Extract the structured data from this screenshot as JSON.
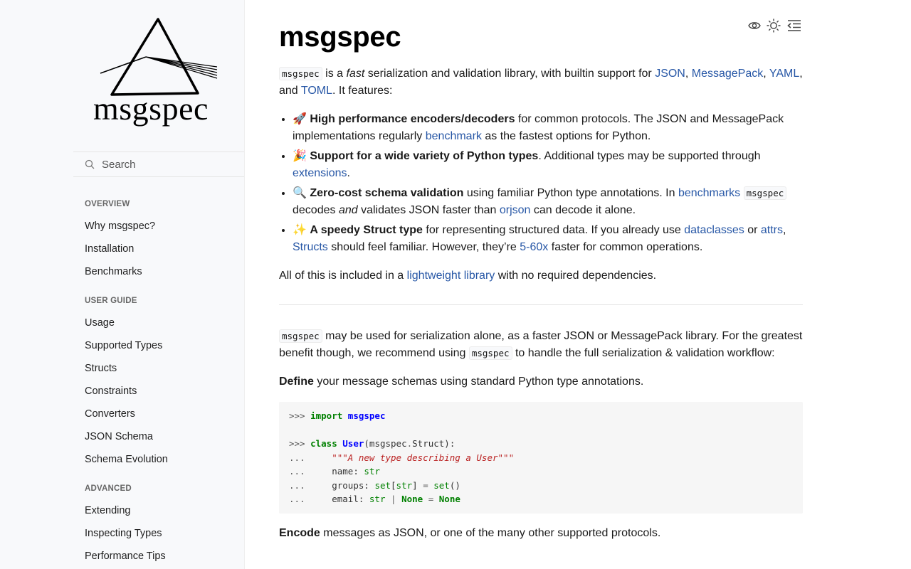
{
  "sidebar": {
    "brand_text": "msgspec",
    "search_placeholder": "Search",
    "sections": [
      {
        "caption": "OVERVIEW",
        "items": [
          "Why msgspec?",
          "Installation",
          "Benchmarks"
        ]
      },
      {
        "caption": "USER GUIDE",
        "items": [
          "Usage",
          "Supported Types",
          "Structs",
          "Constraints",
          "Converters",
          "JSON Schema",
          "Schema Evolution"
        ]
      },
      {
        "caption": "ADVANCED",
        "items": [
          "Extending",
          "Inspecting Types",
          "Performance Tips"
        ]
      }
    ]
  },
  "toolbar": {
    "icons": [
      "eye-icon",
      "theme-sun-icon",
      "toc-icon"
    ]
  },
  "main": {
    "title": "msgspec",
    "intro": {
      "code": "msgspec",
      "t1": " is a ",
      "em": "fast",
      "t2": " serialization and validation library, with builtin support for ",
      "l1": "JSON",
      "t3": ", ",
      "l2": "MessagePack",
      "t4": ", ",
      "l3": "YAML",
      "t5": ", and ",
      "l4": "TOML",
      "t6": ". It features:"
    },
    "features": {
      "f1": {
        "emoji": "🚀",
        "strong": "High performance encoders/decoders",
        "t1": " for common protocols. The JSON and MessagePack implementations regularly ",
        "link": "benchmark",
        "t2": " as the fastest options for Python."
      },
      "f2": {
        "emoji": "🎉",
        "strong": "Support for a wide variety of Python types",
        "t1": ". Additional types may be supported through ",
        "link": "extensions",
        "t2": "."
      },
      "f3": {
        "emoji": "🔍",
        "strong": "Zero-cost schema validation",
        "t1": " using familiar Python type annotations. In ",
        "link1": "benchmarks",
        "t2": " ",
        "code": "msgspec",
        "t3": " decodes ",
        "em": "and",
        "t4": " validates JSON faster than ",
        "link2": "orjson",
        "t5": " can decode it alone."
      },
      "f4": {
        "emoji": "✨",
        "strong": "A speedy Struct type",
        "t1": " for representing structured data. If you already use ",
        "link1": "dataclasses",
        "t2": " or ",
        "link2": "attrs",
        "t3": ", ",
        "link3": "Structs",
        "t4": " should feel familiar. However, they’re ",
        "link4": "5-60x",
        "t5": " faster for common operations."
      }
    },
    "included": {
      "t1": "All of this is included in a ",
      "link": "lightweight library",
      "t2": " with no required dependencies."
    },
    "usage": {
      "code1": "msgspec",
      "t1": " may be used for serialization alone, as a faster JSON or MessagePack library. For the greatest benefit though, we recommend using ",
      "code2": "msgspec",
      "t2": " to handle the full serialization & validation workflow:"
    },
    "define": {
      "strong": "Define",
      "text": " your message schemas using standard Python type annotations."
    },
    "code_block": {
      "prompt": ">>>",
      "cont": "...",
      "import_kw": "import",
      "import_mod": "msgspec",
      "class_kw": "class",
      "class_name": "User",
      "class_base_open": "(msgspec",
      "dot": ".",
      "class_base_close": "Struct):",
      "docstring": "\"\"\"A new type describing a User\"\"\"",
      "name_attr": "name:",
      "str": "str",
      "groups_attr": "groups:",
      "set": "set",
      "lb": "[",
      "rb": "]",
      "eq": "=",
      "parens": "()",
      "email_attr": "email:",
      "pipe": "|",
      "none": "None"
    },
    "encode": {
      "strong": "Encode",
      "text": " messages as JSON, or one of the many other supported protocols."
    }
  }
}
